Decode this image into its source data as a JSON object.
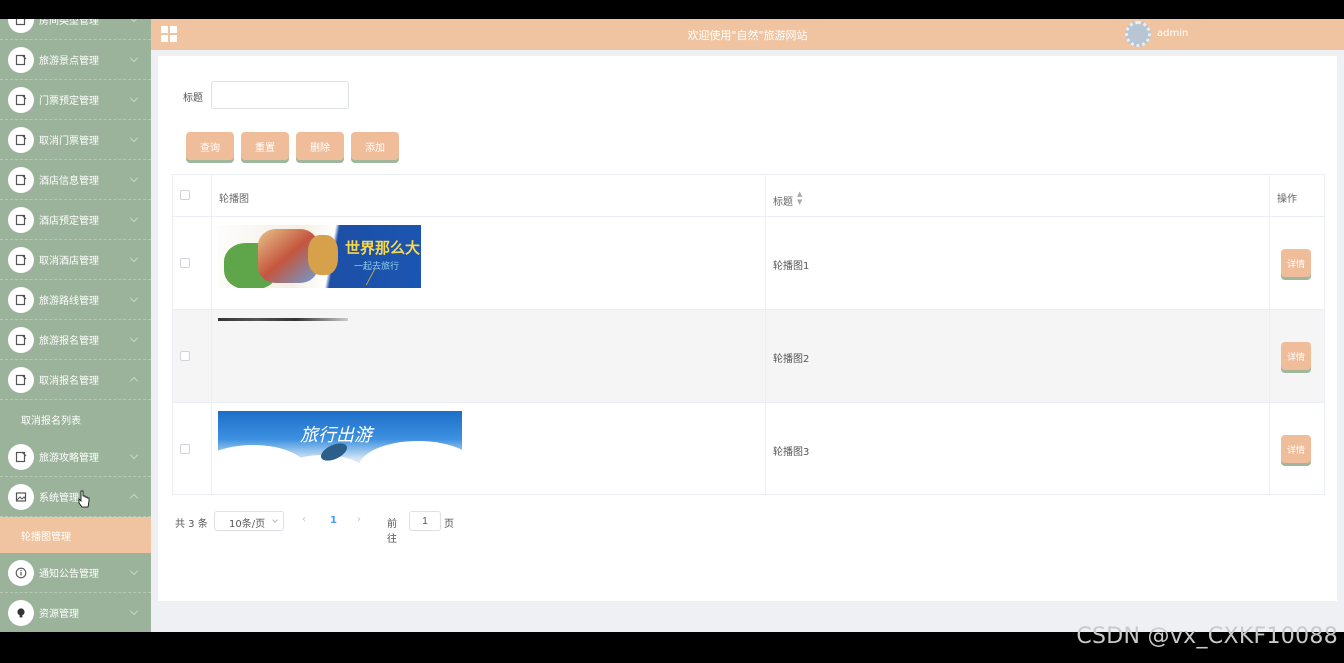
{
  "header": {
    "title": "欢迎使用\"自然\"旅游网站",
    "user": "admin"
  },
  "sidebar": {
    "items": [
      {
        "label": "房间类型管理",
        "icon": "note-icon",
        "expanded": false
      },
      {
        "label": "旅游景点管理",
        "icon": "note-icon",
        "expanded": false
      },
      {
        "label": "门票预定管理",
        "icon": "note-icon",
        "expanded": false
      },
      {
        "label": "取消门票管理",
        "icon": "note-icon",
        "expanded": false
      },
      {
        "label": "酒店信息管理",
        "icon": "note-icon",
        "expanded": false
      },
      {
        "label": "酒店预定管理",
        "icon": "note-icon",
        "expanded": false
      },
      {
        "label": "取消酒店管理",
        "icon": "note-icon",
        "expanded": false
      },
      {
        "label": "旅游路线管理",
        "icon": "note-icon",
        "expanded": false
      },
      {
        "label": "旅游报名管理",
        "icon": "note-icon",
        "expanded": false
      },
      {
        "label": "取消报名管理",
        "icon": "note-icon",
        "expanded": true
      },
      {
        "label": "旅游攻略管理",
        "icon": "note-icon",
        "expanded": false
      },
      {
        "label": "系统管理",
        "icon": "picture-icon",
        "expanded": true
      },
      {
        "label": "通知公告管理",
        "icon": "info-icon",
        "expanded": false
      },
      {
        "label": "资源管理",
        "icon": "lightbulb-icon",
        "expanded": false
      }
    ],
    "sub_cancel_signup": "取消报名列表",
    "sub_carousel": "轮播图管理"
  },
  "filter": {
    "label": "标题",
    "value": ""
  },
  "buttons": {
    "query": "查询",
    "reset": "重置",
    "delete": "删除",
    "add": "添加"
  },
  "table": {
    "headers": {
      "image": "轮播图",
      "title": "标题",
      "action": "操作"
    },
    "rows": [
      {
        "title": "轮播图1",
        "detail": "详情",
        "image_text_main": "世界那么大",
        "image_text_sub": "一起去旅行"
      },
      {
        "title": "轮播图2",
        "detail": "详情"
      },
      {
        "title": "轮播图3",
        "detail": "详情",
        "image_text_main": "旅行出游"
      }
    ]
  },
  "pager": {
    "total": "共 3 条",
    "page_size": "10条/页",
    "prev": "‹",
    "current_page": "1",
    "next": "›",
    "goto_label": "前往",
    "goto_value": "1",
    "page_unit": "页"
  },
  "watermark": "CSDN @vx_CXKF10088",
  "colors": {
    "sidebar": "#9bb39a",
    "accent": "#f0c4a0",
    "button": "#f0bd9b"
  }
}
